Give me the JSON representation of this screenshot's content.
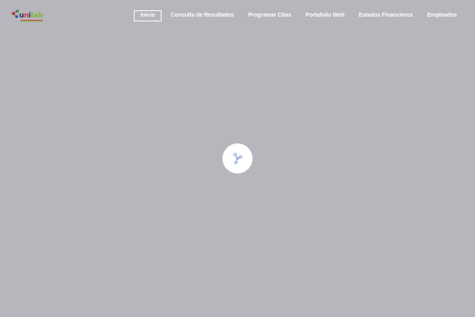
{
  "header": {
    "logo_alt": "unilab",
    "nav": [
      {
        "label": "Inicio",
        "active": true
      },
      {
        "label": "Consulta de Resultados",
        "active": false
      },
      {
        "label": "Programar Citas",
        "active": false
      },
      {
        "label": "Portafolio Web",
        "active": false
      },
      {
        "label": "Estados Financieros",
        "active": false
      },
      {
        "label": "Empleados",
        "active": false
      }
    ]
  },
  "loader": {
    "icon": "molecule-icon"
  },
  "colors": {
    "background": "#b7b6bc",
    "nav_text": "#ffffff",
    "loader_bg": "#ffffff",
    "icon": "#8fb0d8"
  }
}
